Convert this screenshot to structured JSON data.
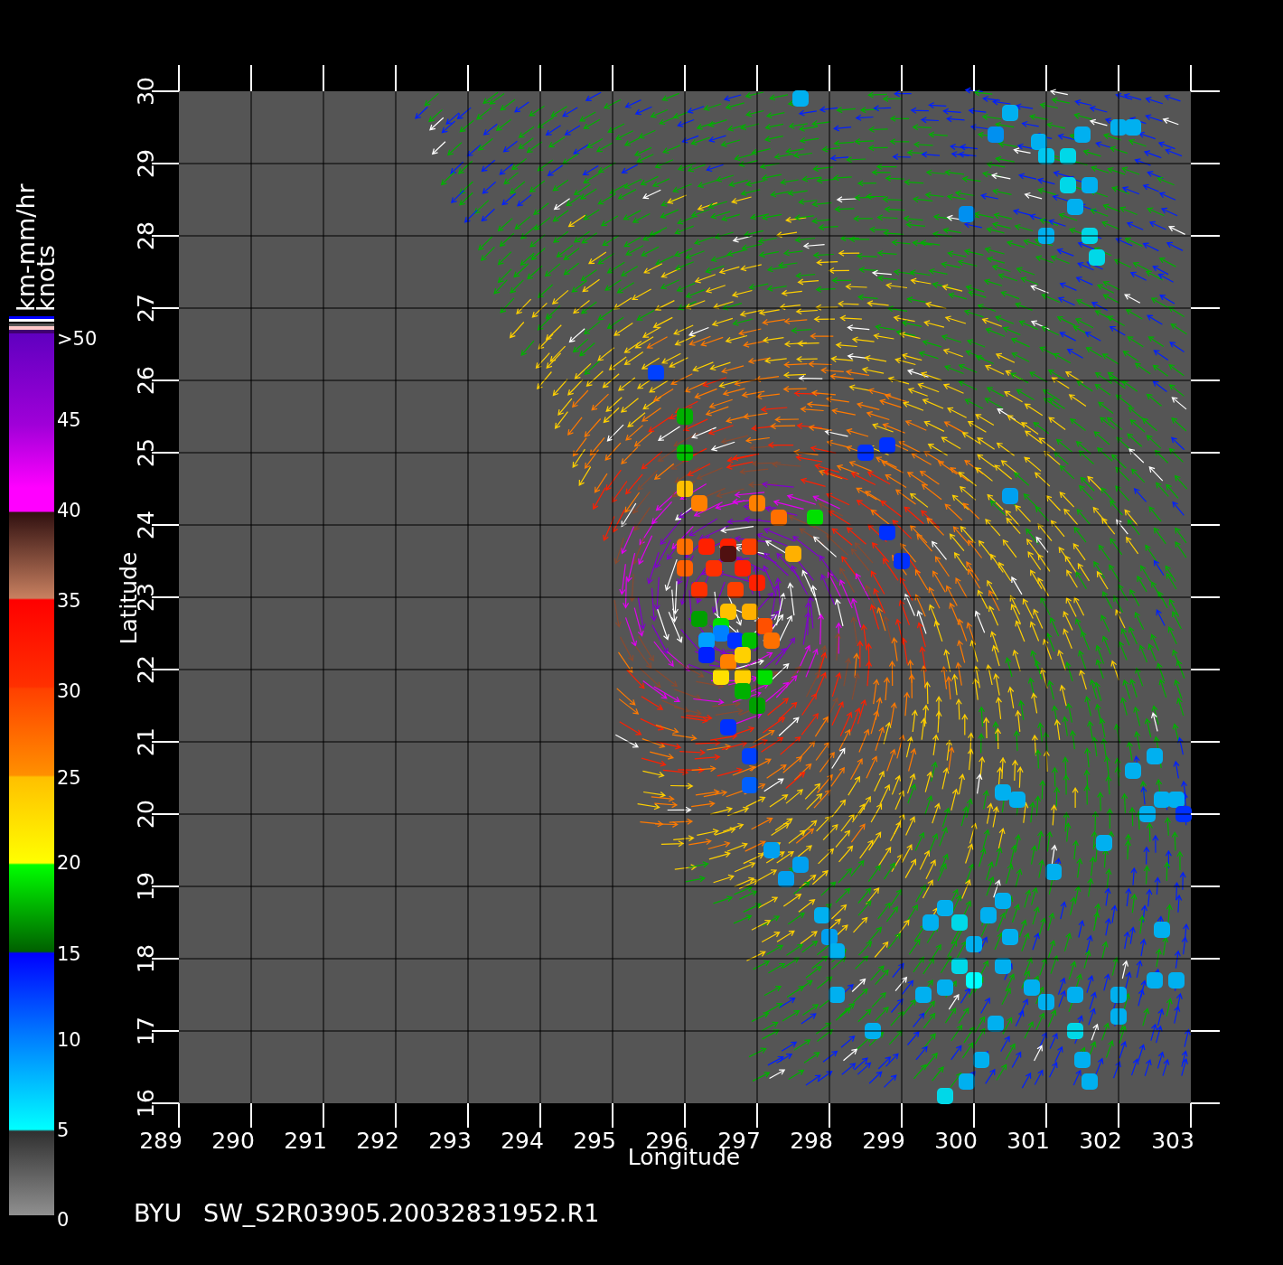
{
  "x_axis": {
    "title": "Longitude",
    "ticks": [
      "289",
      "290",
      "291",
      "292",
      "293",
      "294",
      "295",
      "296",
      "297",
      "298",
      "299",
      "300",
      "301",
      "302",
      "303"
    ]
  },
  "y_axis": {
    "title": "Latitude",
    "ticks": [
      "16",
      "17",
      "18",
      "19",
      "20",
      "21",
      "22",
      "23",
      "24",
      "25",
      "26",
      "27",
      "28",
      "29",
      "30"
    ]
  },
  "color_scale": {
    "units": [
      "km-mm/hr",
      "knots"
    ],
    "labels": [
      ">50",
      "45",
      "40",
      "35",
      "30",
      "25",
      "20",
      "15",
      "10",
      "5",
      "0"
    ]
  },
  "caption": {
    "source": "BYU",
    "file": "SW_S2R03905.20032831952.R1"
  }
}
